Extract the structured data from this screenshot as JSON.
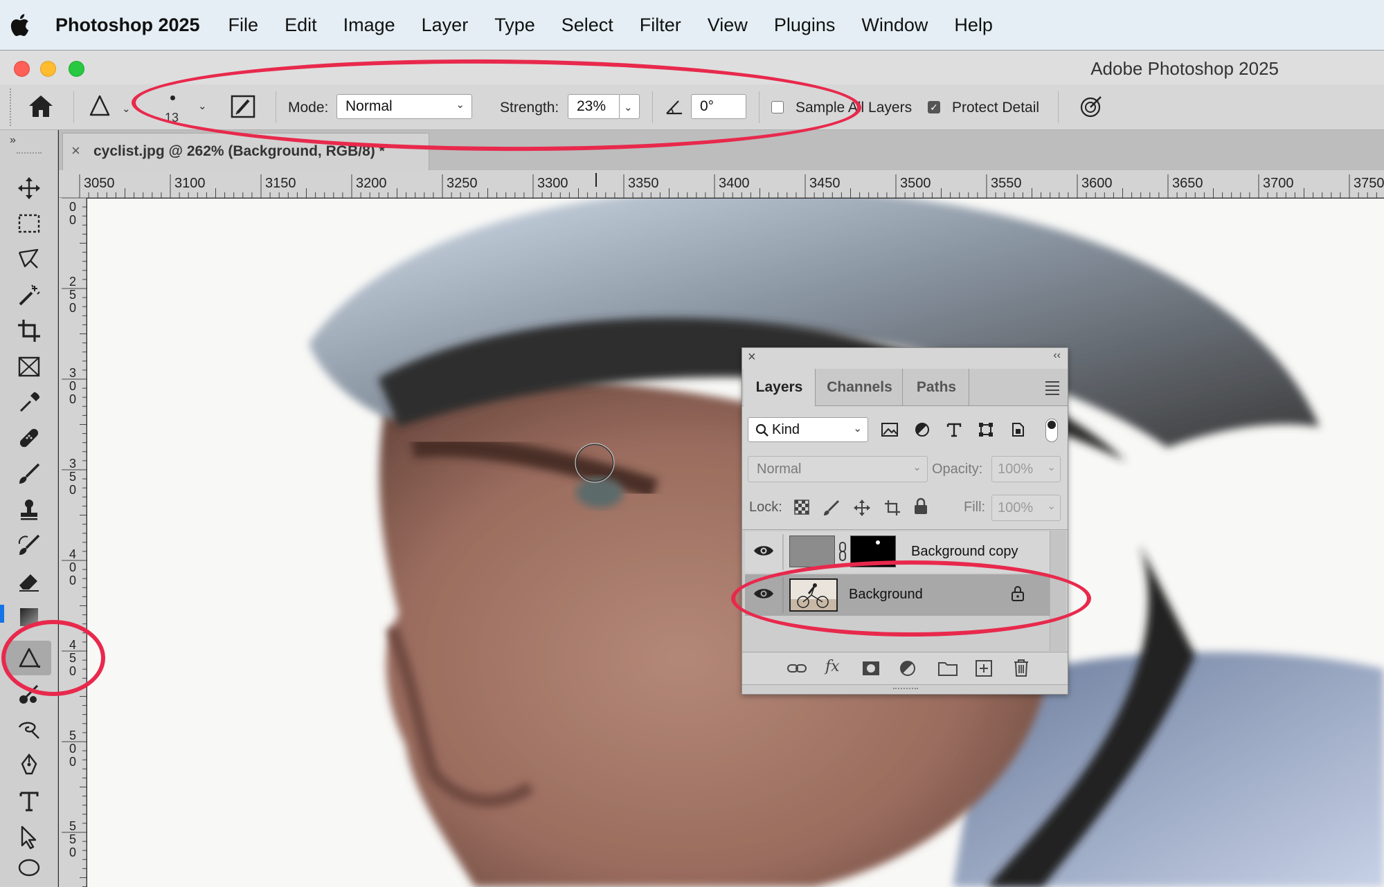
{
  "menubar": {
    "app_name": "Photoshop 2025",
    "items": [
      "File",
      "Edit",
      "Image",
      "Layer",
      "Type",
      "Select",
      "Filter",
      "View",
      "Plugins",
      "Window",
      "Help"
    ]
  },
  "window": {
    "title": "Adobe Photoshop 2025"
  },
  "options": {
    "brush_size": "13",
    "mode_label": "Mode:",
    "mode_value": "Normal",
    "strength_label": "Strength:",
    "strength_value": "23%",
    "angle_value": "0°",
    "sample_all_layers_label": "Sample All Layers",
    "sample_all_layers_checked": false,
    "protect_detail_label": "Protect Detail",
    "protect_detail_checked": true
  },
  "document": {
    "tab_title": "cyclist.jpg @ 262% (Background, RGB/8) *"
  },
  "rulers": {
    "horizontal": [
      "3050",
      "3100",
      "3150",
      "3200",
      "3250",
      "3300",
      "3350",
      "3400",
      "3450",
      "3500",
      "3550",
      "3600",
      "3650",
      "3700",
      "3750"
    ],
    "vertical": [
      "00",
      "250",
      "300",
      "350",
      "400",
      "450",
      "500",
      "550"
    ]
  },
  "layers_panel": {
    "tabs": [
      "Layers",
      "Channels",
      "Paths"
    ],
    "active_tab": "Layers",
    "filter_kind": "Kind",
    "blend_mode": "Normal",
    "opacity_label": "Opacity:",
    "opacity_value": "100%",
    "lock_label": "Lock:",
    "fill_label": "Fill:",
    "fill_value": "100%",
    "layers": [
      {
        "name": "Background copy",
        "locked": false
      },
      {
        "name": "Background",
        "locked": true
      }
    ]
  },
  "colors": {
    "annotation": "#e8294c",
    "menubar_bg": "#e4eef4"
  }
}
